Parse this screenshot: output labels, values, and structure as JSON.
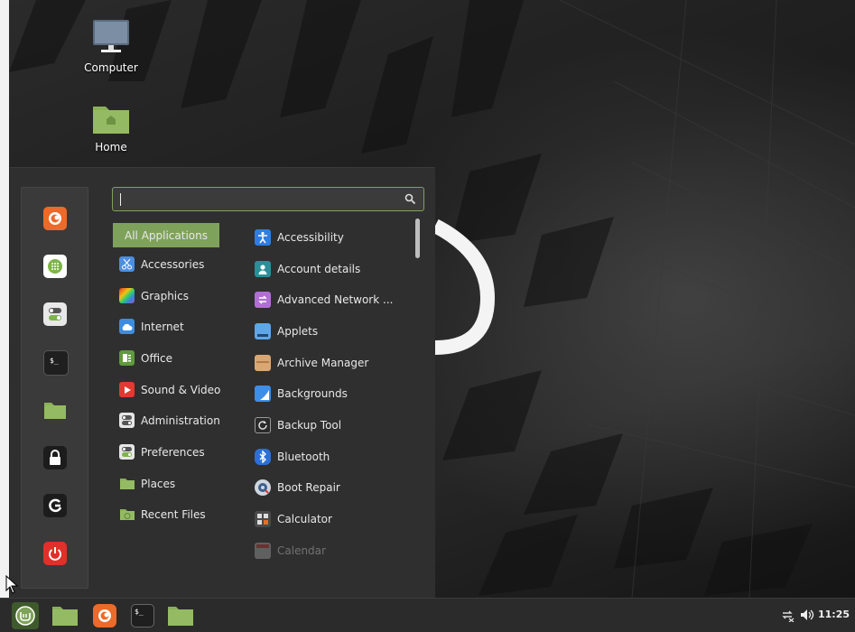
{
  "desktop": {
    "icons": [
      {
        "label": "Computer",
        "icon": "computer-icon"
      },
      {
        "label": "Home",
        "icon": "home-folder-icon"
      }
    ]
  },
  "menu": {
    "search": {
      "value": "",
      "placeholder": ""
    },
    "favorites": [
      {
        "name": "firefox",
        "icon": "firefox-icon"
      },
      {
        "name": "software-manager",
        "icon": "software-manager-icon"
      },
      {
        "name": "system-settings",
        "icon": "settings-toggle-icon"
      },
      {
        "name": "terminal",
        "icon": "terminal-icon"
      },
      {
        "name": "files",
        "icon": "folder-icon"
      },
      {
        "name": "lock-screen",
        "icon": "lock-icon"
      },
      {
        "name": "logout",
        "icon": "logout-icon"
      },
      {
        "name": "quit",
        "icon": "power-icon"
      }
    ],
    "categories": [
      {
        "label": "All Applications",
        "active": true
      },
      {
        "label": "Accessories",
        "icon": "scissors-icon"
      },
      {
        "label": "Graphics",
        "icon": "graphics-icon"
      },
      {
        "label": "Internet",
        "icon": "cloud-icon"
      },
      {
        "label": "Office",
        "icon": "office-icon"
      },
      {
        "label": "Sound & Video",
        "icon": "play-icon"
      },
      {
        "label": "Administration",
        "icon": "admin-toggle-icon"
      },
      {
        "label": "Preferences",
        "icon": "preferences-toggle-icon"
      },
      {
        "label": "Places",
        "icon": "folder-icon"
      },
      {
        "label": "Recent Files",
        "icon": "recent-folder-icon"
      }
    ],
    "applications": [
      {
        "label": "Accessibility",
        "icon": "accessibility-icon"
      },
      {
        "label": "Account details",
        "icon": "account-icon"
      },
      {
        "label": "Advanced Network ...",
        "icon": "network-icon"
      },
      {
        "label": "Applets",
        "icon": "applets-icon"
      },
      {
        "label": "Archive Manager",
        "icon": "archive-icon"
      },
      {
        "label": "Backgrounds",
        "icon": "backgrounds-icon"
      },
      {
        "label": "Backup Tool",
        "icon": "backup-icon"
      },
      {
        "label": "Bluetooth",
        "icon": "bluetooth-icon"
      },
      {
        "label": "Boot Repair",
        "icon": "boot-repair-icon"
      },
      {
        "label": "Calculator",
        "icon": "calculator-icon"
      },
      {
        "label": "Calendar",
        "icon": "calendar-icon"
      }
    ]
  },
  "panel": {
    "launchers": [
      "menu-button",
      "files",
      "firefox",
      "terminal",
      "files"
    ],
    "tray": {
      "network_icon": "network-disconnected-icon",
      "volume_icon": "volume-icon"
    },
    "clock": "11:25"
  },
  "colors": {
    "accent": "#7fa25a",
    "panel": "#2b2b2b",
    "menu_bg": "#2f2f2f"
  }
}
